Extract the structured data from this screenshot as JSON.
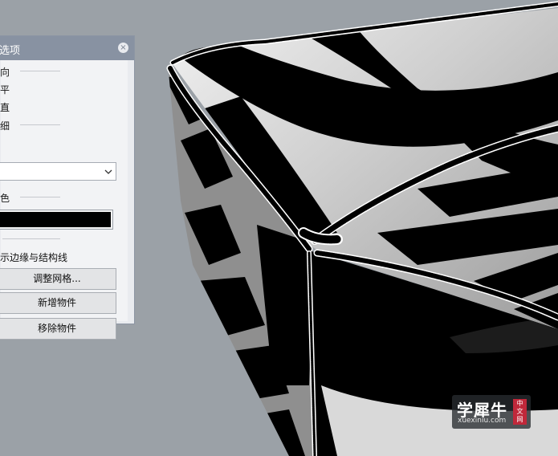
{
  "panel": {
    "title": "选项",
    "close_icon": "×",
    "sections": {
      "direction_label": "向",
      "radio_a": "平",
      "radio_b": "直",
      "thickness_label": "细",
      "color_label": "色"
    },
    "dropdown": {
      "value": ""
    },
    "swatch": {
      "color": "#000000"
    },
    "checkbox_label": "示边缘与结构线",
    "buttons": {
      "adjust_mesh": "调整网格...",
      "add_object": "新增物件",
      "remove_object": "移除物件"
    }
  },
  "watermark": {
    "brand": "学犀牛",
    "url": "xuexiniu.com",
    "seal": "中文网"
  }
}
